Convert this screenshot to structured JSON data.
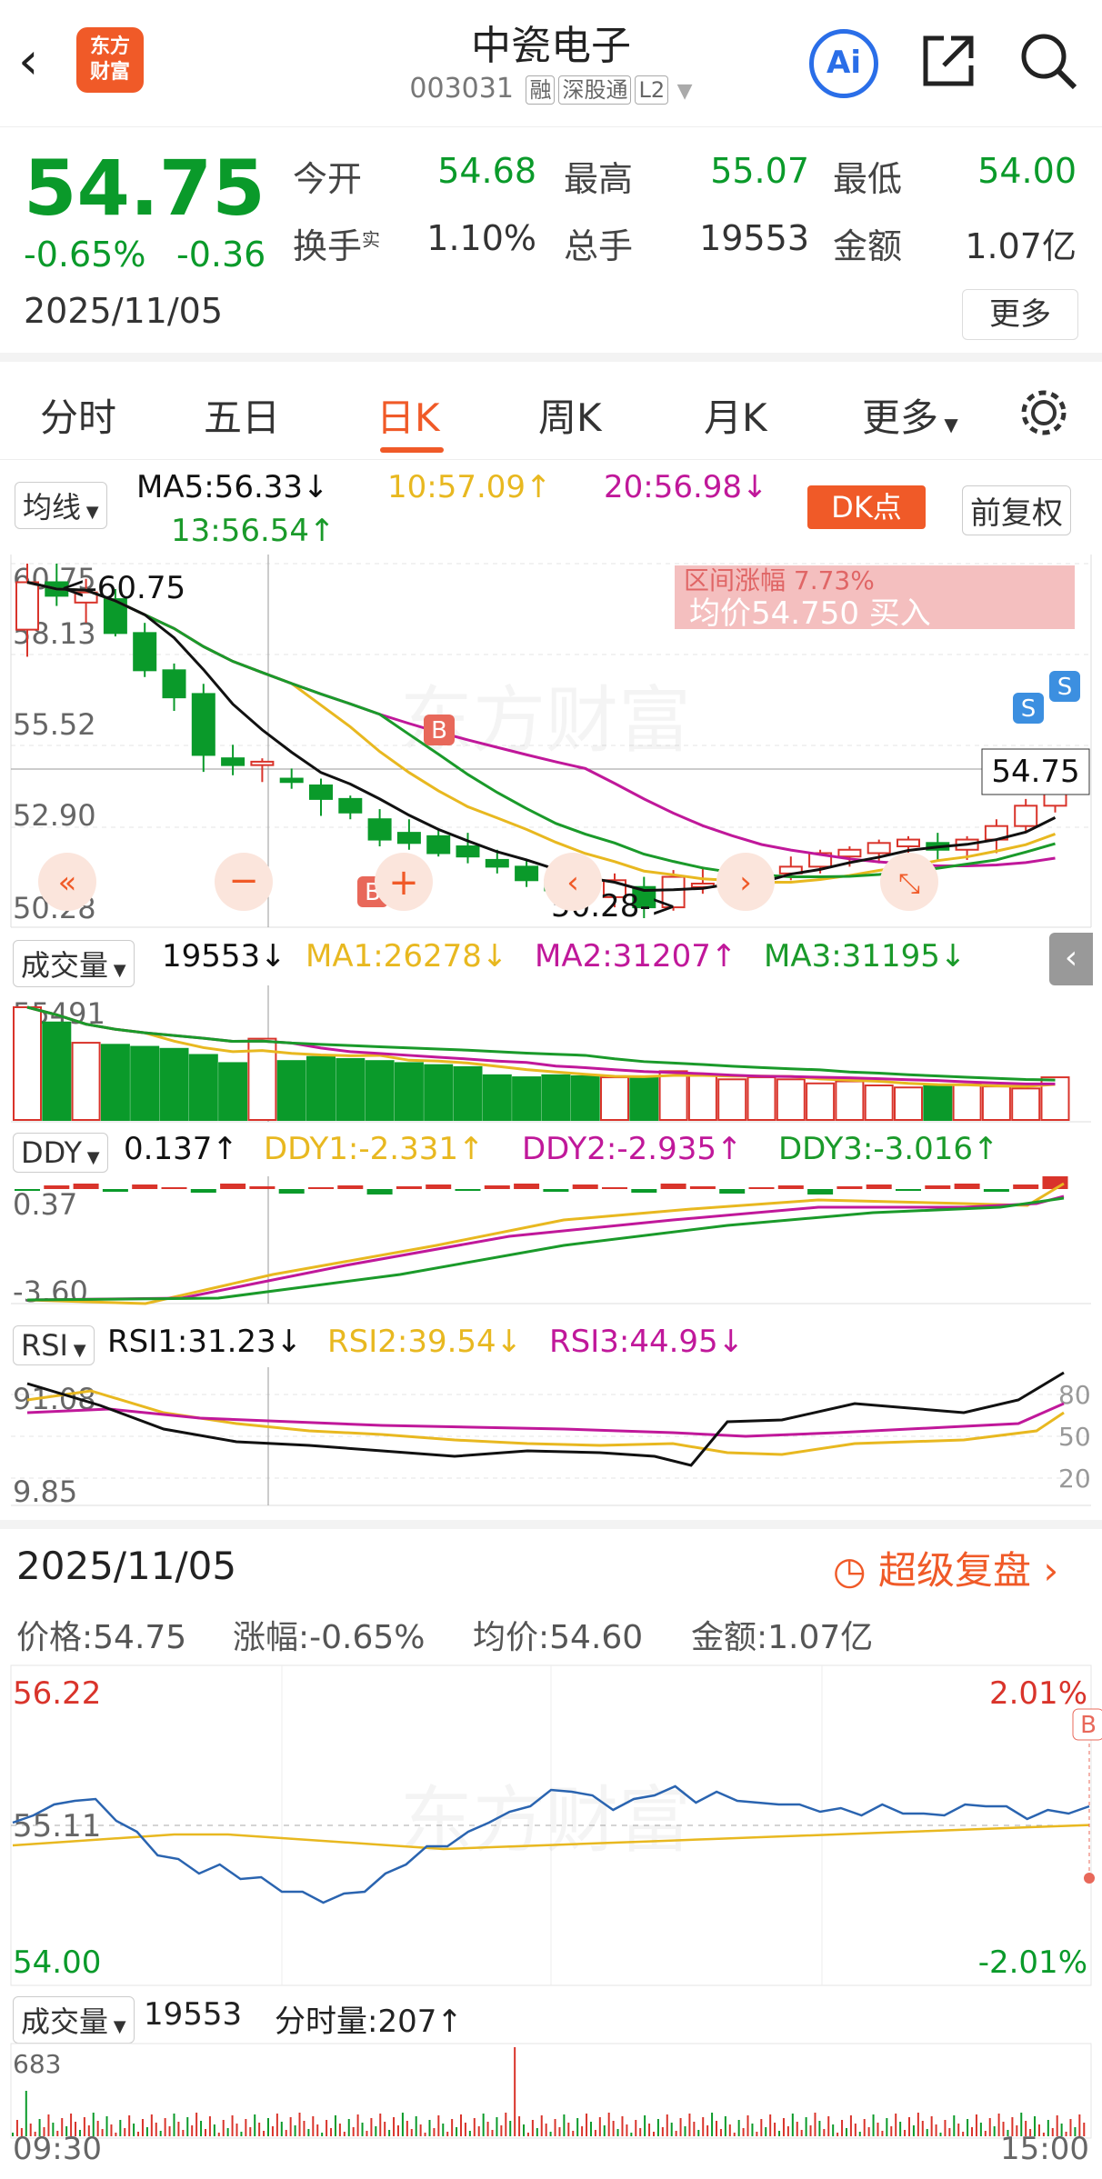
{
  "header": {
    "logo_text": "东方财富",
    "title": "中瓷电子",
    "code": "003031",
    "tags": [
      "融",
      "深股通",
      "L2"
    ]
  },
  "quote": {
    "price": "54.75",
    "pct": "-0.65%",
    "chg": "-0.36",
    "date": "2025/11/05",
    "open_label": "今开",
    "open": "54.68",
    "high_label": "最高",
    "high": "55.07",
    "low_label": "最低",
    "low": "54.00",
    "turnover_label": "换手",
    "turnover_sup": "实",
    "turnover": "1.10%",
    "vol_label": "总手",
    "vol": "19553",
    "amount_label": "金额",
    "amount": "1.07亿",
    "more": "更多"
  },
  "tabs": [
    "分时",
    "五日",
    "日K",
    "周K",
    "月K",
    "更多"
  ],
  "kline": {
    "ma_select": "均线",
    "ma5": "MA5:56.33↓",
    "ma10": "10:57.09↑",
    "ma20": "20:56.98↓",
    "ma13": "13:56.54↑",
    "dk": "DK点",
    "fq": "前复权",
    "y_labels": [
      "60.75",
      "58.13",
      "55.52",
      "52.90",
      "50.28"
    ],
    "max_note": "<-60.75",
    "min_note": "50.28->",
    "last_price": "54.75",
    "overlay_text": "均价54.750 买入",
    "overlay_text2": "区间涨幅 7.73%"
  },
  "volume": {
    "select": "成交量",
    "value": "19553↓",
    "ma1": "MA1:26278↓",
    "ma2": "MA2:31207↑",
    "ma3": "MA3:31195↓",
    "y_label": "55491"
  },
  "ddy": {
    "select": "DDY",
    "value": "0.137↑",
    "ddy1": "DDY1:-2.331↑",
    "ddy2": "DDY2:-2.935↑",
    "ddy3": "DDY3:-3.016↑",
    "y_top": "0.37",
    "y_bot": "-3.60"
  },
  "rsi": {
    "select": "RSI",
    "rsi1": "RSI1:31.23↓",
    "rsi2": "RSI2:39.54↓",
    "rsi3": "RSI3:44.95↓",
    "y_top": "91.08",
    "y_bot": "9.85",
    "r80": "80",
    "r50": "50",
    "r20": "20"
  },
  "detail": {
    "date": "2025/11/05",
    "replay": "超级复盘",
    "price": "价格:54.75",
    "pct": "涨幅:-0.65%",
    "avg": "均价:54.60",
    "amount": "金额:1.07亿"
  },
  "intraday": {
    "high": "56.22",
    "mid": "55.11",
    "low": "54.00",
    "pct_high": "2.01%",
    "pct_low": "-2.01%",
    "vol_select": "成交量",
    "vol": "19553",
    "tick_vol": "分时量:207↑",
    "vol_label": "683",
    "t_start": "09:30",
    "t_end": "15:00"
  },
  "colors": {
    "up": "#d9342b",
    "down": "#0a9a2a",
    "accent": "#f05a28",
    "ma5": "#111111",
    "ma10": "#e8b820",
    "ma20": "#c0189a",
    "ma13": "#1a9a2a"
  }
}
